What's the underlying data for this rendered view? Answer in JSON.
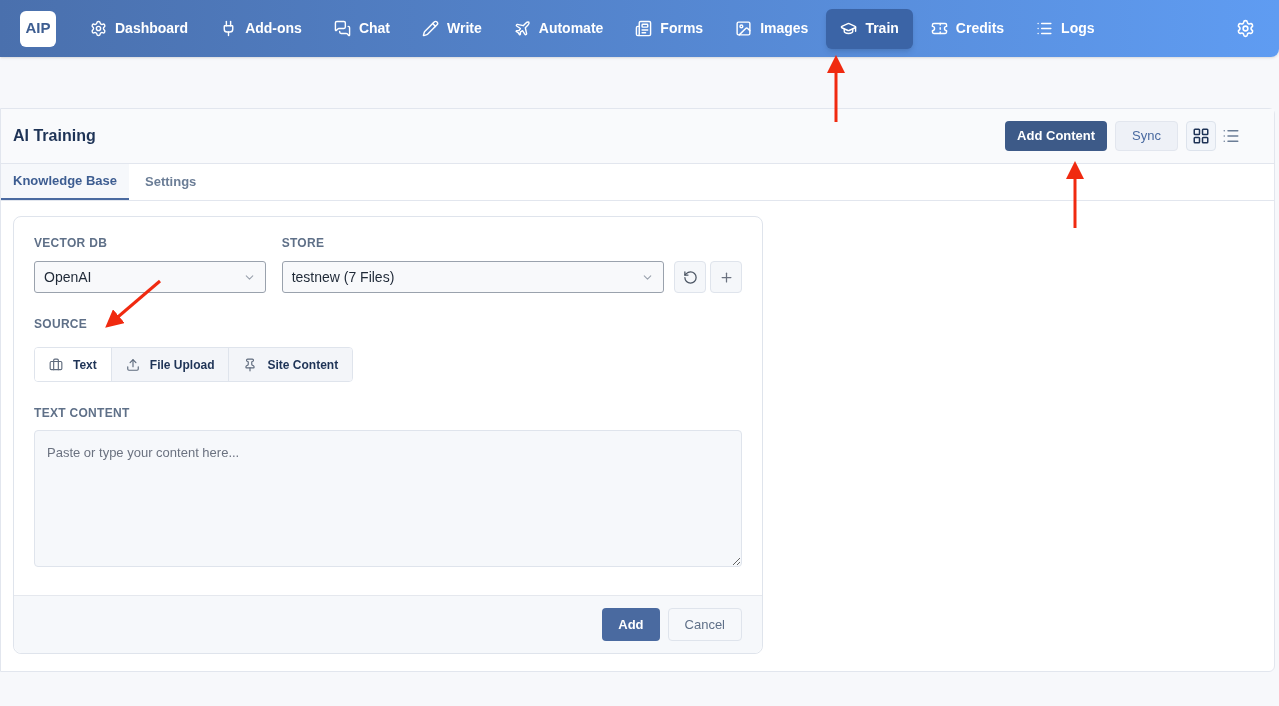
{
  "app": {
    "logo": "AIP"
  },
  "nav": [
    {
      "label": "Dashboard",
      "selected": false
    },
    {
      "label": "Add-ons",
      "selected": false
    },
    {
      "label": "Chat",
      "selected": false
    },
    {
      "label": "Write",
      "selected": false
    },
    {
      "label": "Automate",
      "selected": false
    },
    {
      "label": "Forms",
      "selected": false
    },
    {
      "label": "Images",
      "selected": false
    },
    {
      "label": "Train",
      "selected": true
    },
    {
      "label": "Credits",
      "selected": false
    },
    {
      "label": "Logs",
      "selected": false
    }
  ],
  "page": {
    "title": "AI Training",
    "buttons": [
      {
        "label": "Add Content",
        "kind": "primary"
      },
      {
        "label": "Sync",
        "kind": "secondary"
      }
    ],
    "views": [
      {
        "selected": true
      },
      {
        "selected": false
      }
    ]
  },
  "tabs": [
    {
      "label": "Knowledge Base",
      "selected": true
    },
    {
      "label": "Settings",
      "selected": false
    }
  ],
  "form": {
    "vector_db": {
      "label": "VECTOR DB",
      "value": "OpenAI"
    },
    "store": {
      "label": "STORE",
      "value": "testnew (7 Files)"
    },
    "source": {
      "label": "SOURCE",
      "options": [
        {
          "label": "Text",
          "selected": true
        },
        {
          "label": "File Upload",
          "selected": false
        },
        {
          "label": "Site Content",
          "selected": false
        }
      ]
    },
    "text_content": {
      "label": "TEXT CONTENT",
      "placeholder": "Paste or type your content here..."
    },
    "actions": [
      {
        "label": "Add",
        "kind": "primary"
      },
      {
        "label": "Cancel",
        "kind": "secondary"
      }
    ]
  }
}
